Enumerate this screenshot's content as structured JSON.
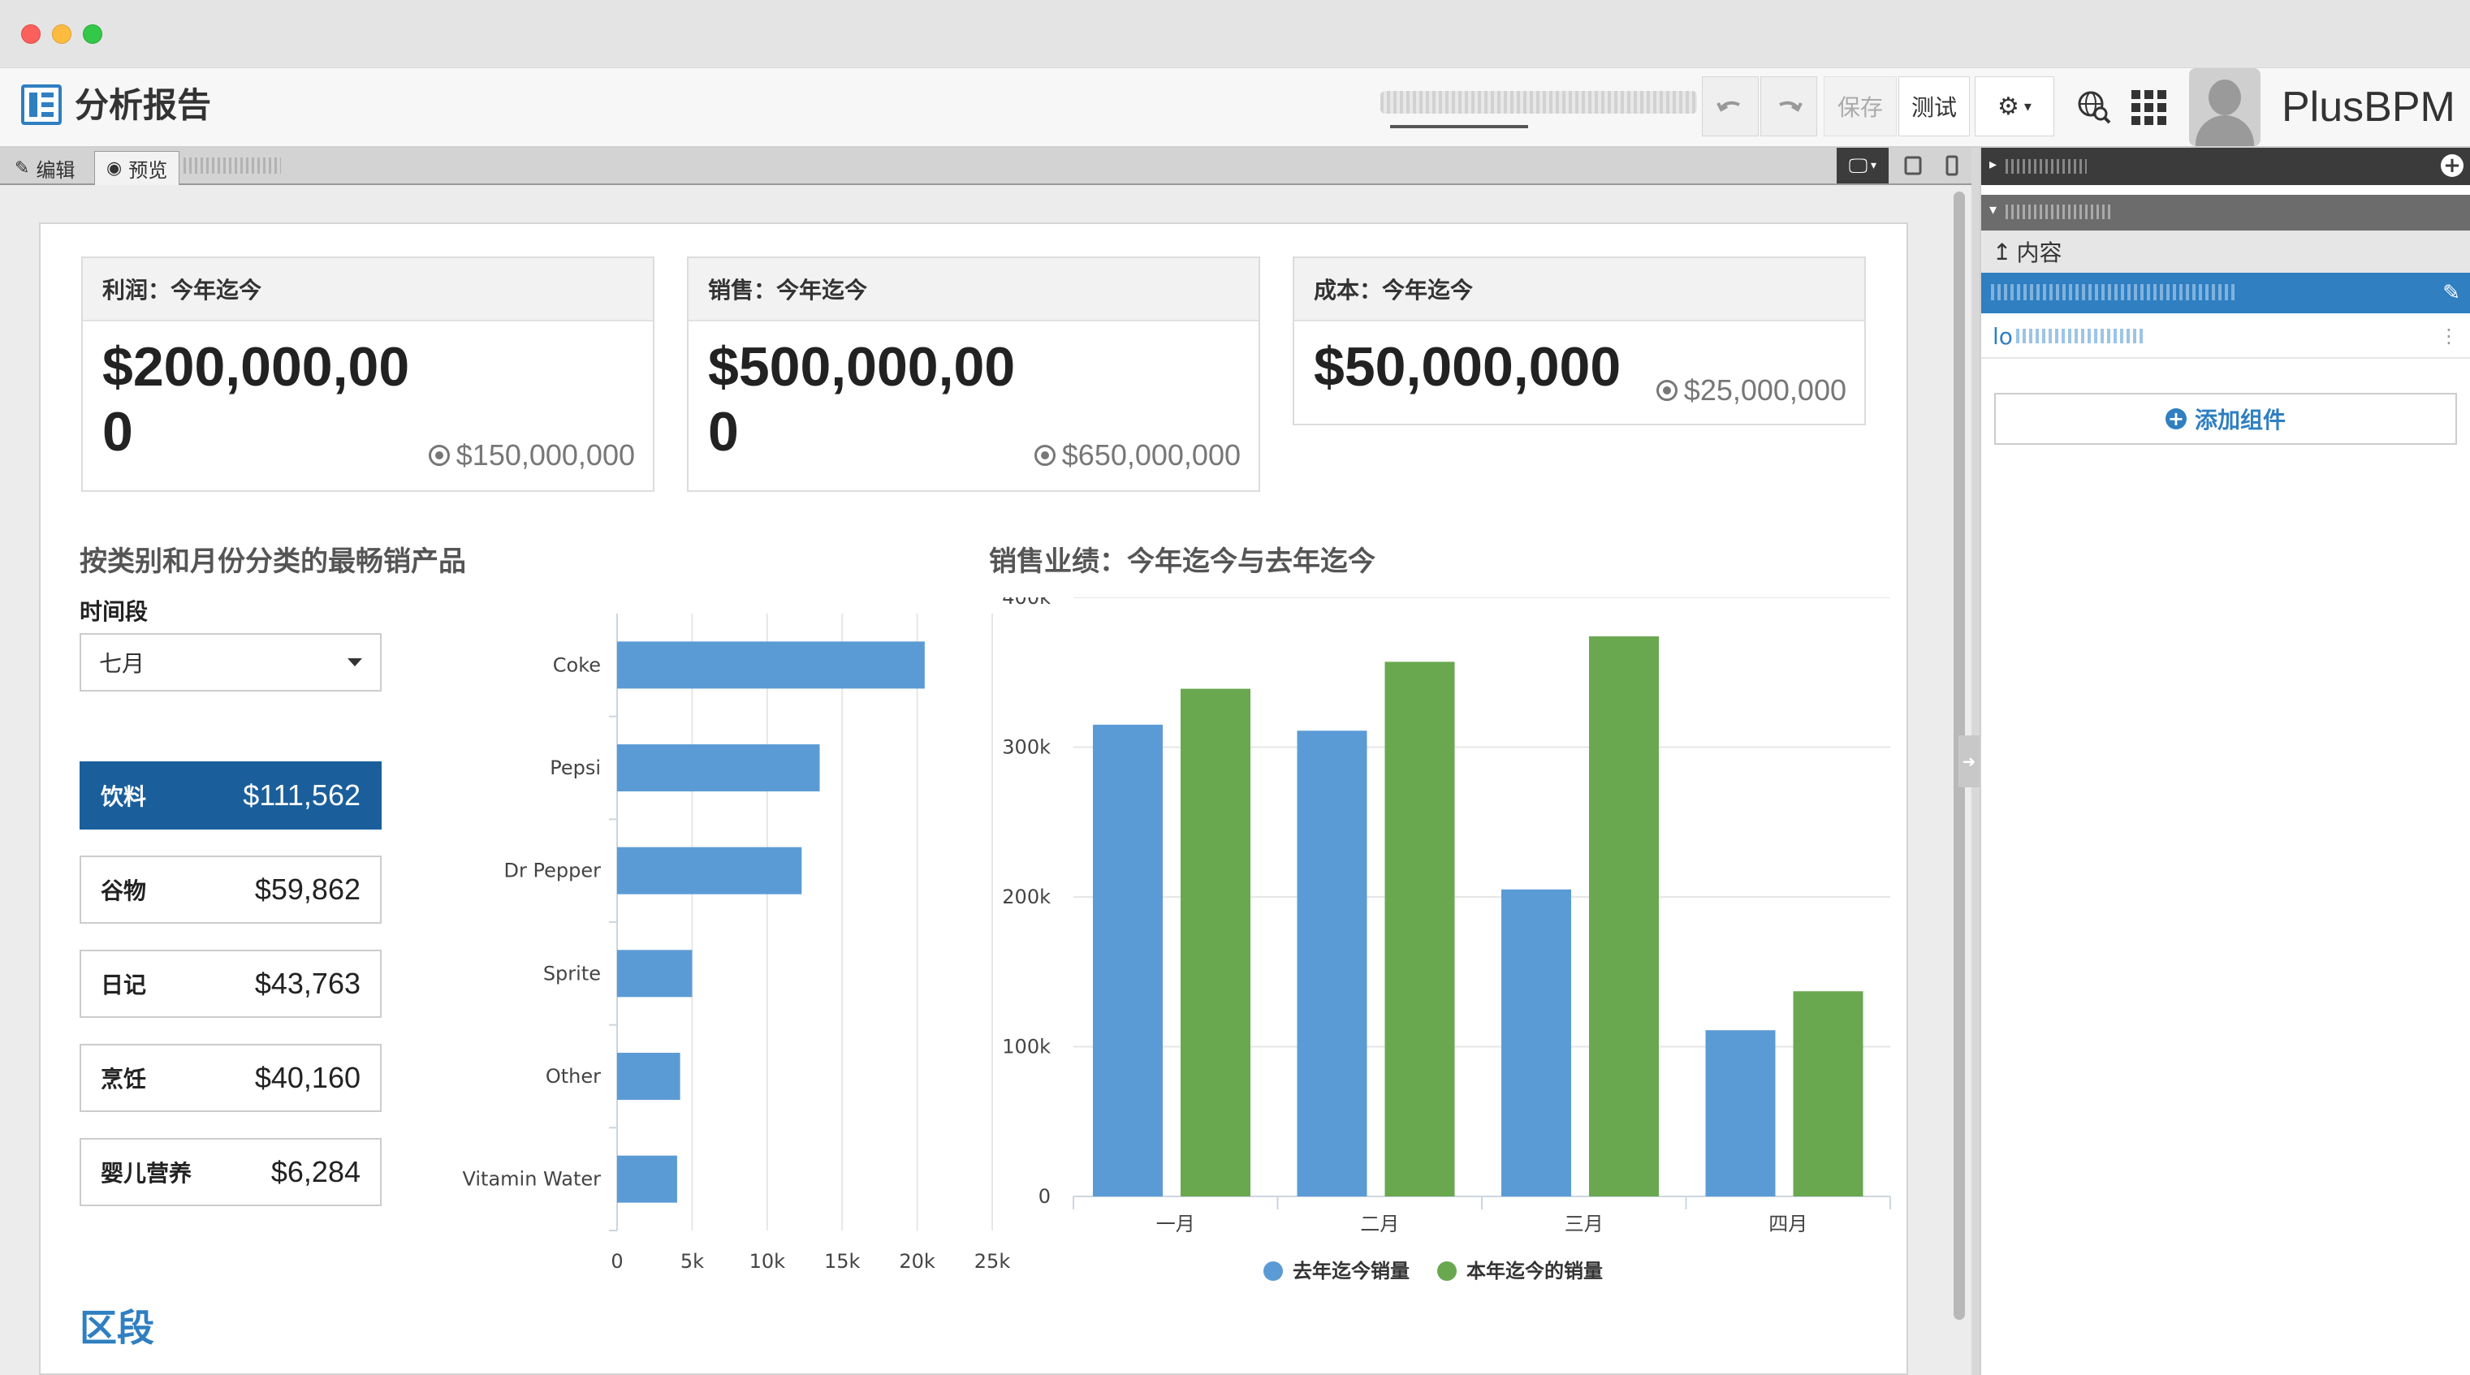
{
  "app": {
    "title": "分析报告",
    "brand": "PlusBPM",
    "toolbar": {
      "save_label": "保存",
      "test_label": "测试"
    }
  },
  "tabs": {
    "edit": "编辑",
    "preview": "预览"
  },
  "kpis": [
    {
      "title": "利润：今年迄今",
      "value_line1": "$200,000,00",
      "value_line2": "0",
      "target": "$150,000,000"
    },
    {
      "title": "销售：今年迄今",
      "value_line1": "$500,000,00",
      "value_line2": "0",
      "target": "$650,000,000"
    },
    {
      "title": "成本：今年迄今",
      "value_line1": "$50,000,000",
      "value_line2": "",
      "target": "$25,000,000"
    }
  ],
  "top_products": {
    "title": "按类别和月份分类的最畅销产品",
    "period_label": "时间段",
    "period_value": "七月",
    "categories": [
      {
        "name": "饮料",
        "amount": "$111,562",
        "active": true
      },
      {
        "name": "谷物",
        "amount": "$59,862",
        "active": false
      },
      {
        "name": "日记",
        "amount": "$43,763",
        "active": false
      },
      {
        "name": "烹饪",
        "amount": "$40,160",
        "active": false
      },
      {
        "name": "婴儿营养",
        "amount": "$6,284",
        "active": false
      }
    ]
  },
  "sales_perf": {
    "title": "销售业绩：今年迄今与去年迄今"
  },
  "bottom_title": "区段",
  "right_panel": {
    "content_label": "内容",
    "item_prefix": "lo",
    "add_component": "添加组件"
  },
  "colors": {
    "blue": "#5b9bd5",
    "green": "#69a84f",
    "accent": "#1a5f9c"
  },
  "chart_data": [
    {
      "type": "bar",
      "orientation": "horizontal",
      "categories": [
        "Coke",
        "Pepsi",
        "Dr Pepper",
        "Sprite",
        "Other",
        "Vitamin Water"
      ],
      "values": [
        20500,
        13500,
        12300,
        5000,
        4200,
        4000
      ],
      "xlim": [
        0,
        25000
      ],
      "xticks": [
        "0",
        "5k",
        "10k",
        "15k",
        "20k",
        "25k"
      ],
      "grid": true
    },
    {
      "type": "bar",
      "categories": [
        "一月",
        "二月",
        "三月",
        "四月"
      ],
      "series": [
        {
          "name": "去年迄今销量",
          "values": [
            315000,
            311000,
            205000,
            111000
          ]
        },
        {
          "name": "本年迄今的销量",
          "values": [
            339000,
            357000,
            374000,
            137000
          ]
        }
      ],
      "ylim": [
        0,
        400000
      ],
      "yticks": [
        "0",
        "100k",
        "200k",
        "300k",
        "400k"
      ],
      "legend": "bottom",
      "grid": true
    }
  ]
}
